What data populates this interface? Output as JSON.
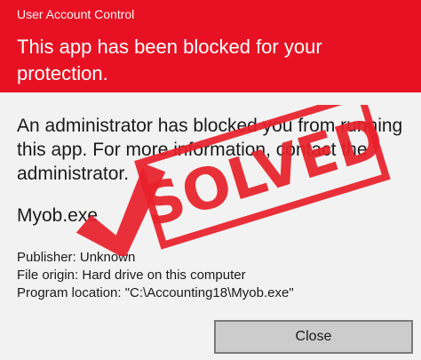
{
  "window": {
    "caption": "User Account Control",
    "title": "This app has been blocked for your protection.",
    "header_color": "#e81123"
  },
  "body": {
    "message": "An administrator has blocked you from running this app. For more information, contact the administrator.",
    "app_name": "Myob.exe",
    "publisher": "Publisher: Unknown",
    "file_origin": "File origin: Hard drive on this computer",
    "program_location": "Program location: \"C:\\Accounting18\\Myob.exe\""
  },
  "buttons": {
    "close_label": "Close"
  },
  "stamp": {
    "text": "SOLVED",
    "color": "#e8202a",
    "icon": "checkmark-icon"
  }
}
